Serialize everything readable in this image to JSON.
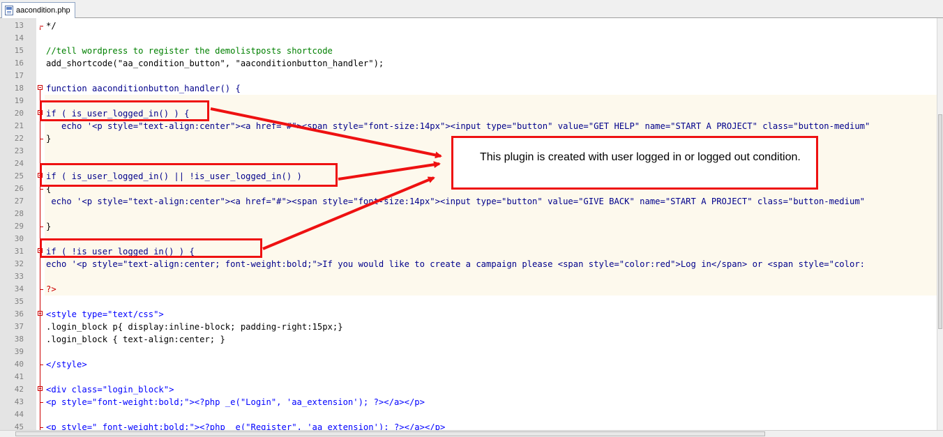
{
  "tab": {
    "filename": "aacondition.php",
    "icon": "php-file-icon"
  },
  "callout": {
    "text": "This plugin is created with user logged in or logged out condition."
  },
  "lines": [
    {
      "n": "13",
      "code": "*/"
    },
    {
      "n": "14",
      "code": ""
    },
    {
      "n": "15",
      "code": "//tell wordpress to register the demolistposts shortcode"
    },
    {
      "n": "16",
      "code": "add_shortcode(\"aa_condition_button\", \"aaconditionbutton_handler\");"
    },
    {
      "n": "17",
      "code": ""
    },
    {
      "n": "18",
      "code": "function aaconditionbutton_handler() {"
    },
    {
      "n": "19",
      "code": ""
    },
    {
      "n": "20",
      "code": "if ( is_user_logged_in() ) {"
    },
    {
      "n": "21",
      "code": "   echo '<p style=\"text-align:center\"><a href=\"#\"><span style=\"font-size:14px\"><input type=\"button\" value=\"GET HELP\" name=\"START A PROJECT\" class=\"button-medium\""
    },
    {
      "n": "22",
      "code": "}"
    },
    {
      "n": "23",
      "code": ""
    },
    {
      "n": "24",
      "code": ""
    },
    {
      "n": "25",
      "code": "if ( is_user_logged_in() || !is_user_logged_in() )"
    },
    {
      "n": "26",
      "code": "{"
    },
    {
      "n": "27",
      "code": " echo '<p style=\"text-align:center\"><a href=\"#\"><span style=\"font-size:14px\"><input type=\"button\" value=\"GIVE BACK\" name=\"START A PROJECT\" class=\"button-medium\""
    },
    {
      "n": "28",
      "code": ""
    },
    {
      "n": "29",
      "code": "}"
    },
    {
      "n": "30",
      "code": ""
    },
    {
      "n": "31",
      "code": "if ( !is_user_logged_in() ) {"
    },
    {
      "n": "32",
      "code": "echo '<p style=\"text-align:center; font-weight:bold;\">If you would like to create a campaign please <span style=\"color:red\">Log in</span> or <span style=\"color:"
    },
    {
      "n": "33",
      "code": ""
    },
    {
      "n": "34",
      "code": "?>"
    },
    {
      "n": "35",
      "code": ""
    },
    {
      "n": "36",
      "code": "<style type=\"text/css\">"
    },
    {
      "n": "37",
      "code": ".login_block p{ display:inline-block; padding-right:15px;}"
    },
    {
      "n": "38",
      "code": ".login_block { text-align:center; }"
    },
    {
      "n": "39",
      "code": ""
    },
    {
      "n": "40",
      "code": "</style>"
    },
    {
      "n": "41",
      "code": ""
    },
    {
      "n": "42",
      "code": "<div class=\"login_block\">"
    },
    {
      "n": "43",
      "code": "<p style=\"font-weight:bold;\"><?php _e(\"Login\", 'aa_extension'); ?></a></p>"
    },
    {
      "n": "44",
      "code": ""
    },
    {
      "n": "45",
      "code": "<p style=\" font-weight:bold;\"><?php _e(\"Register\", 'aa_extension'); ?></a></p>"
    }
  ]
}
